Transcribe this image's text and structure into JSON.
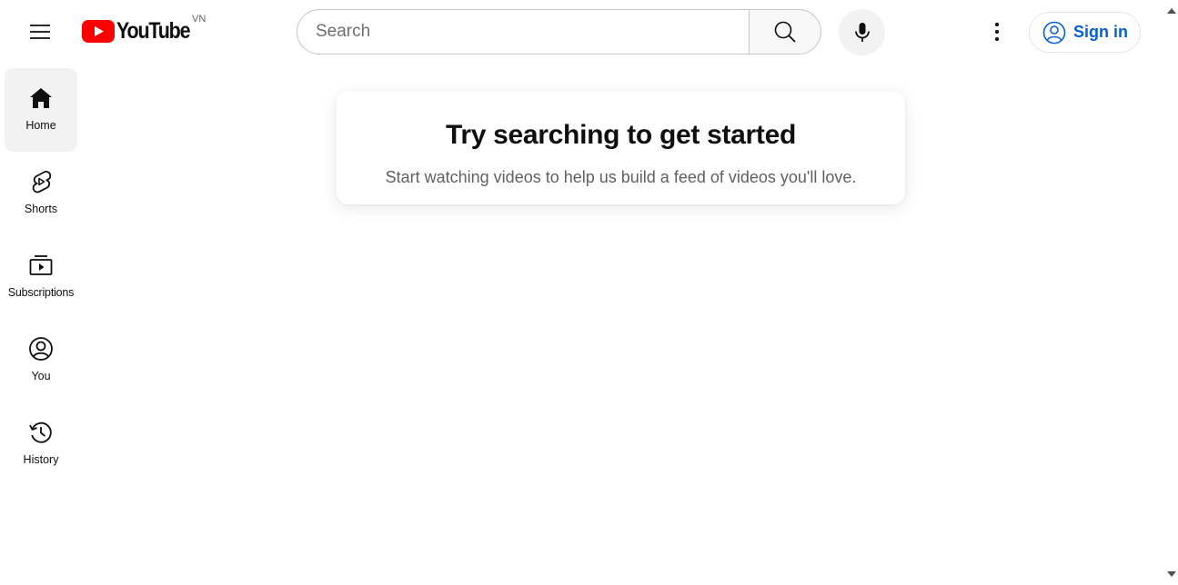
{
  "header": {
    "logo_text": "YouTube",
    "country_code": "VN",
    "search_placeholder": "Search",
    "sign_in_label": "Sign in",
    "brand_red": "#ff0000",
    "link_blue": "#065fd4"
  },
  "sidebar": {
    "items": [
      {
        "label": "Home",
        "icon": "home-icon",
        "active": true
      },
      {
        "label": "Shorts",
        "icon": "shorts-icon"
      },
      {
        "label": "Subscriptions",
        "icon": "subscriptions-icon"
      },
      {
        "label": "You",
        "icon": "you-icon"
      },
      {
        "label": "History",
        "icon": "history-icon"
      }
    ]
  },
  "main": {
    "empty_title": "Try searching to get started",
    "empty_subtitle": "Start watching videos to help us build a feed of videos you'll love."
  }
}
